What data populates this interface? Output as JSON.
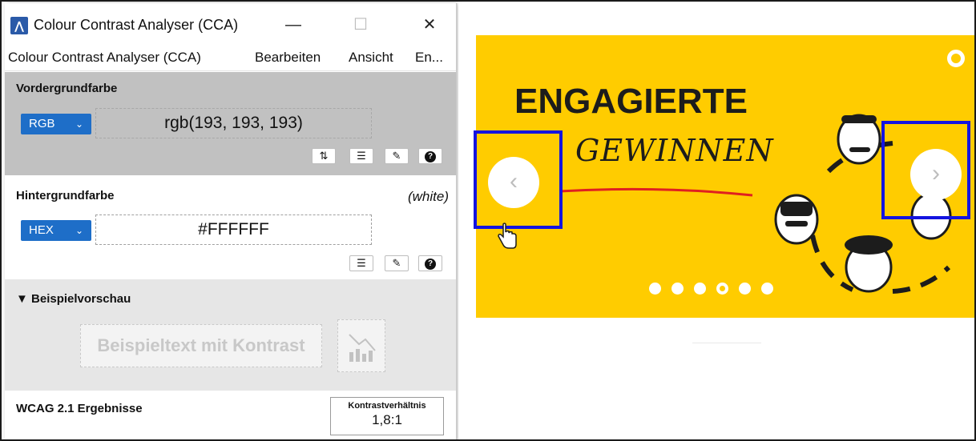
{
  "window": {
    "title": "Colour Contrast Analyser (CCA)",
    "minimize_glyph": "—",
    "maximize_glyph": "☐",
    "close_glyph": "✕"
  },
  "menubar": {
    "items": [
      "Colour Contrast Analyser (CCA)",
      "Bearbeiten",
      "Ansicht",
      "En..."
    ]
  },
  "foreground": {
    "title": "Vordergrundfarbe",
    "format": "RGB",
    "value": "rgb(193, 193, 193)",
    "tools": [
      "swap-icon",
      "sliders-icon",
      "eyedropper-icon",
      "help-icon"
    ]
  },
  "background": {
    "title": "Hintergrundfarbe",
    "name_note": "(white)",
    "format": "HEX",
    "value": "#FFFFFF",
    "tools": [
      "sliders-icon",
      "eyedropper-icon",
      "help-icon"
    ]
  },
  "preview": {
    "title": "▼ Beispielvorschau",
    "sample_text": "Beispieltext mit Kontrast"
  },
  "wcag": {
    "title": "WCAG 2.1 Ergebnisse",
    "ratio_label": "Kontrastverhältnis",
    "ratio_value": "1,8:1"
  },
  "carousel": {
    "headline": "ENGAGIERTE",
    "subline": "GEWINNEN",
    "prev_glyph": "‹",
    "next_glyph": "›",
    "slide_count": 6,
    "active_slide": 4,
    "background_color": "#ffcc00",
    "highlight_color": "#1414e0"
  }
}
